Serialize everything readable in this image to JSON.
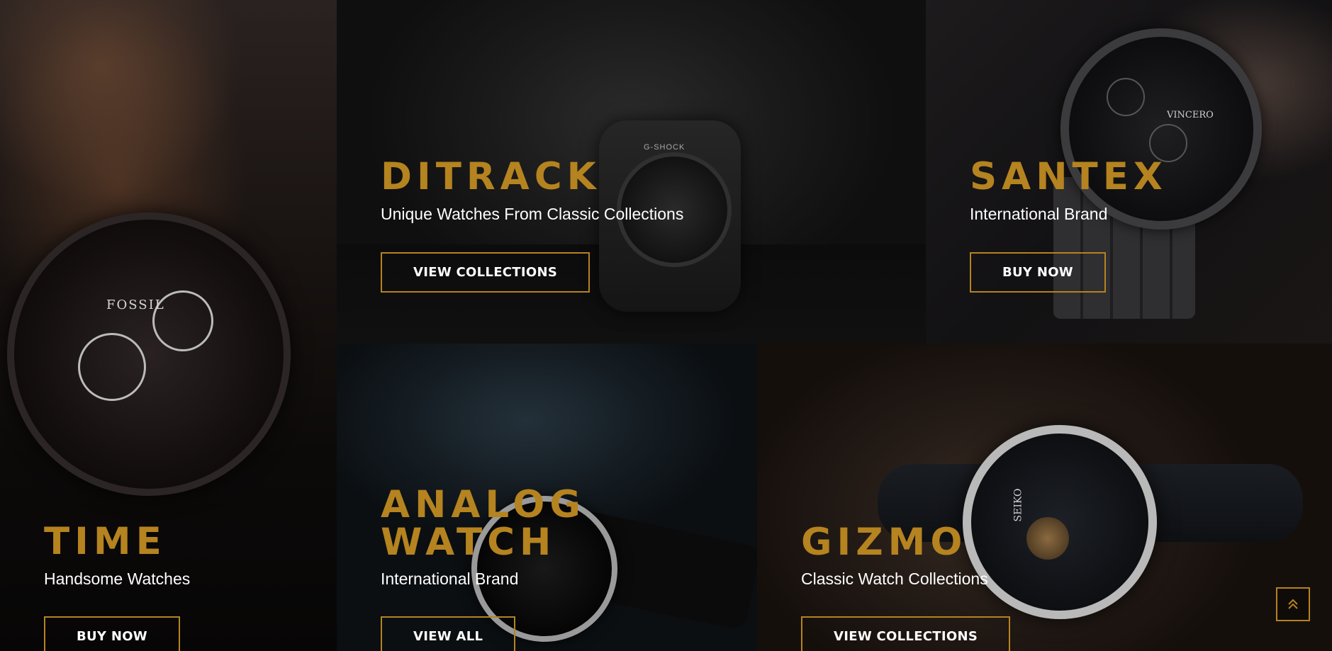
{
  "tiles": {
    "time": {
      "title": "TIME",
      "subtitle": "Handsome Watches",
      "button": "BUY NOW"
    },
    "ditrack": {
      "title": "DITRACK",
      "subtitle": "Unique Watches From Classic Collections",
      "button": "VIEW COLLECTIONS"
    },
    "santex": {
      "title": "SANTEX",
      "subtitle": "International Brand",
      "button": "BUY NOW"
    },
    "analog": {
      "title_line1": "ANALOG",
      "title_line2": "WATCH",
      "subtitle": "International Brand",
      "button": "VIEW ALL"
    },
    "gizmo": {
      "title": "GIZMO",
      "subtitle": "Classic Watch Collections",
      "button": "VIEW COLLECTIONS"
    }
  },
  "watch_marks": {
    "time": "FOSSIL",
    "ditrack": "G-SHOCK",
    "santex": "VINCERO",
    "gizmo": "SEIKO"
  },
  "scroll_top": {
    "icon": "double-chevron-up-icon"
  },
  "colors": {
    "accent": "#b5831f",
    "text": "#ffffff",
    "background": "#050505"
  }
}
